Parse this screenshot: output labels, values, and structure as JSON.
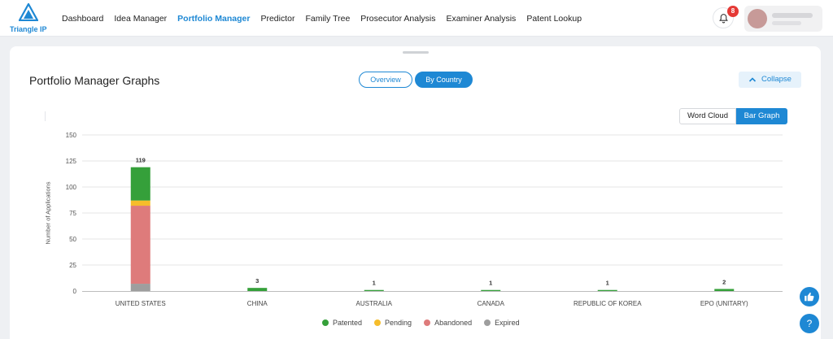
{
  "app": {
    "logo_text": "Triangle IP",
    "nav": [
      "Dashboard",
      "Idea Manager",
      "Portfolio Manager",
      "Predictor",
      "Family Tree",
      "Prosecutor Analysis",
      "Examiner Analysis",
      "Patent Lookup"
    ],
    "active_nav": "Portfolio Manager",
    "notifications_count": "8",
    "accent_color": "#1e88d4"
  },
  "card": {
    "title": "Portfolio Manager Graphs",
    "tabs": [
      {
        "label": "Overview",
        "selected": false
      },
      {
        "label": "By Country",
        "selected": true
      }
    ],
    "collapse_label": "Collapse",
    "view_toggle": [
      {
        "label": "Word Cloud",
        "selected": false
      },
      {
        "label": "Bar Graph",
        "selected": true
      }
    ]
  },
  "chart_data": {
    "type": "bar",
    "stacked": true,
    "ylabel": "Number of Applications",
    "ylim": [
      0,
      150
    ],
    "yticks": [
      0,
      25,
      50,
      75,
      100,
      125,
      150
    ],
    "categories": [
      "UNITED STATES",
      "CHINA",
      "AUSTRALIA",
      "CANADA",
      "REPUBLIC OF KOREA",
      "EPO (UNITARY)"
    ],
    "series": [
      {
        "name": "Expired",
        "color": "#9e9e9e",
        "values": [
          7,
          0,
          0,
          0,
          0,
          0
        ]
      },
      {
        "name": "Abandoned",
        "color": "#de7b7b",
        "values": [
          75,
          0,
          0,
          0,
          0,
          0
        ]
      },
      {
        "name": "Pending",
        "color": "#f6bd2b",
        "values": [
          5,
          0,
          0,
          0,
          0,
          0
        ]
      },
      {
        "name": "Patented",
        "color": "#35a03a",
        "values": [
          32,
          3,
          1,
          1,
          1,
          2
        ]
      }
    ],
    "totals": [
      119,
      3,
      1,
      1,
      1,
      2
    ],
    "legend_order": [
      "Patented",
      "Pending",
      "Abandoned",
      "Expired"
    ],
    "legend_position": "bottom",
    "grid": true
  }
}
